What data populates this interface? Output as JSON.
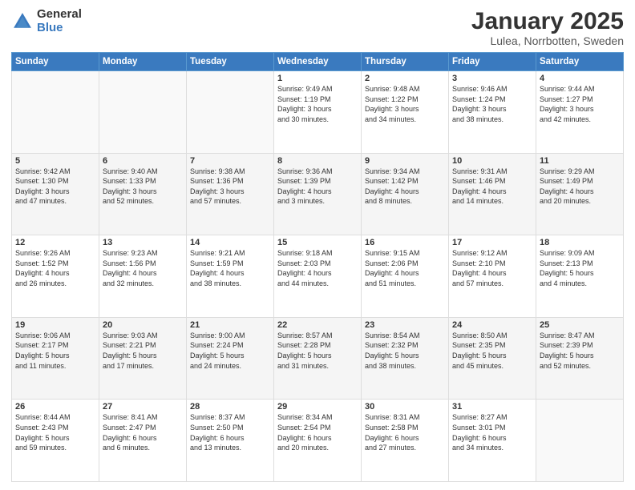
{
  "header": {
    "logo_general": "General",
    "logo_blue": "Blue",
    "main_title": "January 2025",
    "subtitle": "Lulea, Norrbotten, Sweden"
  },
  "weekdays": [
    "Sunday",
    "Monday",
    "Tuesday",
    "Wednesday",
    "Thursday",
    "Friday",
    "Saturday"
  ],
  "weeks": [
    [
      {
        "day": "",
        "info": ""
      },
      {
        "day": "",
        "info": ""
      },
      {
        "day": "",
        "info": ""
      },
      {
        "day": "1",
        "info": "Sunrise: 9:49 AM\nSunset: 1:19 PM\nDaylight: 3 hours\nand 30 minutes."
      },
      {
        "day": "2",
        "info": "Sunrise: 9:48 AM\nSunset: 1:22 PM\nDaylight: 3 hours\nand 34 minutes."
      },
      {
        "day": "3",
        "info": "Sunrise: 9:46 AM\nSunset: 1:24 PM\nDaylight: 3 hours\nand 38 minutes."
      },
      {
        "day": "4",
        "info": "Sunrise: 9:44 AM\nSunset: 1:27 PM\nDaylight: 3 hours\nand 42 minutes."
      }
    ],
    [
      {
        "day": "5",
        "info": "Sunrise: 9:42 AM\nSunset: 1:30 PM\nDaylight: 3 hours\nand 47 minutes."
      },
      {
        "day": "6",
        "info": "Sunrise: 9:40 AM\nSunset: 1:33 PM\nDaylight: 3 hours\nand 52 minutes."
      },
      {
        "day": "7",
        "info": "Sunrise: 9:38 AM\nSunset: 1:36 PM\nDaylight: 3 hours\nand 57 minutes."
      },
      {
        "day": "8",
        "info": "Sunrise: 9:36 AM\nSunset: 1:39 PM\nDaylight: 4 hours\nand 3 minutes."
      },
      {
        "day": "9",
        "info": "Sunrise: 9:34 AM\nSunset: 1:42 PM\nDaylight: 4 hours\nand 8 minutes."
      },
      {
        "day": "10",
        "info": "Sunrise: 9:31 AM\nSunset: 1:46 PM\nDaylight: 4 hours\nand 14 minutes."
      },
      {
        "day": "11",
        "info": "Sunrise: 9:29 AM\nSunset: 1:49 PM\nDaylight: 4 hours\nand 20 minutes."
      }
    ],
    [
      {
        "day": "12",
        "info": "Sunrise: 9:26 AM\nSunset: 1:52 PM\nDaylight: 4 hours\nand 26 minutes."
      },
      {
        "day": "13",
        "info": "Sunrise: 9:23 AM\nSunset: 1:56 PM\nDaylight: 4 hours\nand 32 minutes."
      },
      {
        "day": "14",
        "info": "Sunrise: 9:21 AM\nSunset: 1:59 PM\nDaylight: 4 hours\nand 38 minutes."
      },
      {
        "day": "15",
        "info": "Sunrise: 9:18 AM\nSunset: 2:03 PM\nDaylight: 4 hours\nand 44 minutes."
      },
      {
        "day": "16",
        "info": "Sunrise: 9:15 AM\nSunset: 2:06 PM\nDaylight: 4 hours\nand 51 minutes."
      },
      {
        "day": "17",
        "info": "Sunrise: 9:12 AM\nSunset: 2:10 PM\nDaylight: 4 hours\nand 57 minutes."
      },
      {
        "day": "18",
        "info": "Sunrise: 9:09 AM\nSunset: 2:13 PM\nDaylight: 5 hours\nand 4 minutes."
      }
    ],
    [
      {
        "day": "19",
        "info": "Sunrise: 9:06 AM\nSunset: 2:17 PM\nDaylight: 5 hours\nand 11 minutes."
      },
      {
        "day": "20",
        "info": "Sunrise: 9:03 AM\nSunset: 2:21 PM\nDaylight: 5 hours\nand 17 minutes."
      },
      {
        "day": "21",
        "info": "Sunrise: 9:00 AM\nSunset: 2:24 PM\nDaylight: 5 hours\nand 24 minutes."
      },
      {
        "day": "22",
        "info": "Sunrise: 8:57 AM\nSunset: 2:28 PM\nDaylight: 5 hours\nand 31 minutes."
      },
      {
        "day": "23",
        "info": "Sunrise: 8:54 AM\nSunset: 2:32 PM\nDaylight: 5 hours\nand 38 minutes."
      },
      {
        "day": "24",
        "info": "Sunrise: 8:50 AM\nSunset: 2:35 PM\nDaylight: 5 hours\nand 45 minutes."
      },
      {
        "day": "25",
        "info": "Sunrise: 8:47 AM\nSunset: 2:39 PM\nDaylight: 5 hours\nand 52 minutes."
      }
    ],
    [
      {
        "day": "26",
        "info": "Sunrise: 8:44 AM\nSunset: 2:43 PM\nDaylight: 5 hours\nand 59 minutes."
      },
      {
        "day": "27",
        "info": "Sunrise: 8:41 AM\nSunset: 2:47 PM\nDaylight: 6 hours\nand 6 minutes."
      },
      {
        "day": "28",
        "info": "Sunrise: 8:37 AM\nSunset: 2:50 PM\nDaylight: 6 hours\nand 13 minutes."
      },
      {
        "day": "29",
        "info": "Sunrise: 8:34 AM\nSunset: 2:54 PM\nDaylight: 6 hours\nand 20 minutes."
      },
      {
        "day": "30",
        "info": "Sunrise: 8:31 AM\nSunset: 2:58 PM\nDaylight: 6 hours\nand 27 minutes."
      },
      {
        "day": "31",
        "info": "Sunrise: 8:27 AM\nSunset: 3:01 PM\nDaylight: 6 hours\nand 34 minutes."
      },
      {
        "day": "",
        "info": ""
      }
    ]
  ]
}
